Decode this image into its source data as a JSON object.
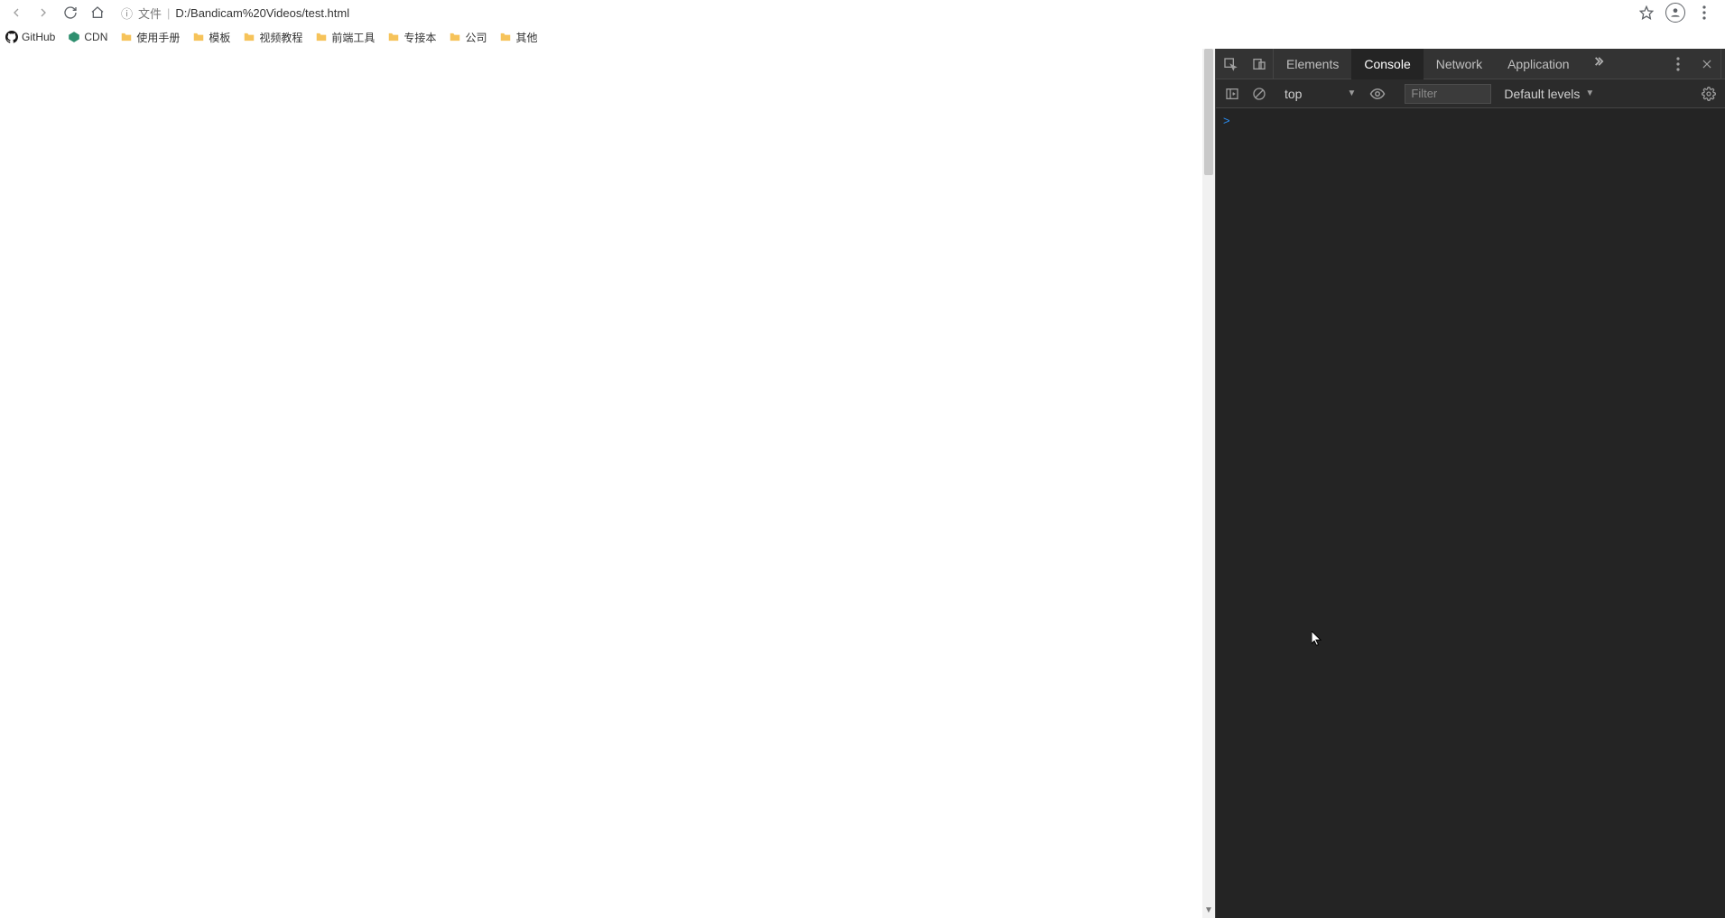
{
  "browser": {
    "file_label": "文件",
    "url": "D:/Bandicam%20Videos/test.html"
  },
  "bookmarks": [
    {
      "icon": "github",
      "label": "GitHub"
    },
    {
      "icon": "cdn",
      "label": "CDN"
    },
    {
      "icon": "folder",
      "label": "使用手册"
    },
    {
      "icon": "folder",
      "label": "模板"
    },
    {
      "icon": "folder",
      "label": "视频教程"
    },
    {
      "icon": "folder",
      "label": "前端工具"
    },
    {
      "icon": "folder",
      "label": "专接本"
    },
    {
      "icon": "folder",
      "label": "公司"
    },
    {
      "icon": "folder",
      "label": "其他"
    }
  ],
  "devtools": {
    "tabs": [
      "Elements",
      "Console",
      "Network",
      "Application"
    ],
    "active_tab": "Console",
    "context": "top",
    "filter_placeholder": "Filter",
    "levels_label": "Default levels",
    "prompt": ">"
  }
}
